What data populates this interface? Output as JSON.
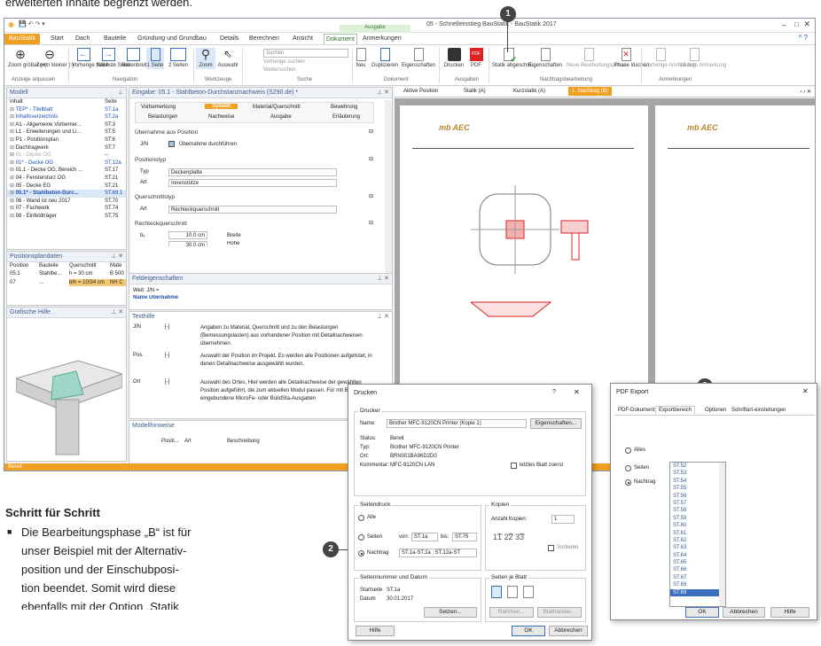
{
  "top_text": "erweiterten Inhalte begrenzt werden.",
  "window": {
    "title": "05 - Schnelleinstieg BauStatik - BauStatik 2017",
    "context_tab_group": "Ausgabe",
    "tabs": [
      "BauStatik",
      "Start",
      "Dach",
      "Bauteile",
      "Gründung und Grundbau",
      "Details",
      "Berechnen",
      "Ansicht",
      "Dokument",
      "Anmerkungen"
    ],
    "active_tab": "Dokument"
  },
  "ribbon": {
    "buttons": [
      {
        "label": "Zoom größer (+)",
        "icon": "zoom-in-icon"
      },
      {
        "label": "Zoom kleiner (-)",
        "icon": "zoom-out-icon"
      },
      {
        "label": "Vorherige Seite",
        "icon": "prev-page-icon"
      },
      {
        "label": "Nächste Seite",
        "icon": "next-page-icon"
      },
      {
        "label": "Seitenbreite",
        "icon": "page-width-icon"
      },
      {
        "label": "1 Seite",
        "icon": "one-page-icon"
      },
      {
        "label": "2 Seiten",
        "icon": "two-pages-icon"
      },
      {
        "label": "Zoom",
        "icon": "zoom-tool-icon"
      },
      {
        "label": "Auswahl",
        "icon": "select-cursor-icon"
      },
      {
        "label": "Neu",
        "icon": "new-doc-icon"
      },
      {
        "label": "Duplizieren",
        "icon": "duplicate-icon"
      },
      {
        "label": "Eigenschaften",
        "icon": "properties-icon"
      },
      {
        "label": "Drucken",
        "icon": "printer-icon"
      },
      {
        "label": "PDF",
        "icon": "pdf-icon"
      },
      {
        "label": "Statik abgeschlo...",
        "icon": "statik-done-icon"
      },
      {
        "label": "Eigenschaften",
        "icon": "properties-icon"
      },
      {
        "label": "Neue Bearbeitungsphase",
        "icon": "new-phase-icon"
      },
      {
        "label": "Phase löschen",
        "icon": "delete-phase-icon"
      },
      {
        "label": "Vorherige Anmerkung",
        "icon": "prev-note-icon"
      },
      {
        "label": "Nächste Anmerkung",
        "icon": "next-note-icon"
      }
    ],
    "search_placeholder": "Suchen",
    "search_prev": "Vorherige suchen",
    "search_next": "Weitersuchen",
    "groups": [
      "Anzeige anpassen",
      "Navigation",
      "Werkzeuge",
      "Suche",
      "Dokument",
      "Ausgaben",
      "Nachtragsbearbeitung",
      "Anmerkungen"
    ]
  },
  "model_panel": {
    "title": "Modell",
    "col_inhalt": "Inhalt",
    "col_seite": "Seite",
    "items": [
      {
        "label": "TEP* - Titelblatt",
        "page": "ST.1a",
        "style": "blue"
      },
      {
        "label": "Inhaltsverzeichnis",
        "page": "ST.2a",
        "style": "blue"
      },
      {
        "label": "A1 - Allgemeine Vorbemer...",
        "page": "ST.3",
        "style": ""
      },
      {
        "label": "L1 - Erweiterungen und Li...",
        "page": "ST.5",
        "style": ""
      },
      {
        "label": "P1 - Positionsplan",
        "page": "ST.6",
        "style": ""
      },
      {
        "label": "Dachtragwerk",
        "page": "ST.7",
        "style": ""
      },
      {
        "label": "01 - Decke OG",
        "page": "--",
        "style": "gray"
      },
      {
        "label": "01* - Decke OG",
        "page": "ST.12a",
        "style": "blue"
      },
      {
        "label": "01.1 - Decke OG, Bereich ...",
        "page": "ST.17",
        "style": ""
      },
      {
        "label": "04 - Fenstersturz OG",
        "page": "ST.21",
        "style": ""
      },
      {
        "label": "05 - Decke EG",
        "page": "ST.21",
        "style": ""
      },
      {
        "label": "05.1* - Stahlbeton-Durc...",
        "page": "ST.69.1",
        "style": "bold"
      },
      {
        "label": "06 - Wand ist neu 2017",
        "page": "ST.70",
        "style": ""
      },
      {
        "label": "07 - Fachwerk",
        "page": "ST.74",
        "style": ""
      },
      {
        "label": "08 - Einfeldträger",
        "page": "ST.75",
        "style": ""
      }
    ]
  },
  "position_panel": {
    "title": "Positionsplandaten",
    "headers": [
      "Position",
      "Bauteile",
      "Querschnitt",
      "Mate"
    ],
    "rows": [
      [
        "05.1",
        "Stahlbe...",
        "h = 30 cm",
        "B 500"
      ],
      [
        "07",
        "...",
        "b/h = 10/34 cm",
        "NH C"
      ]
    ]
  },
  "help_panel": {
    "title": "Grafische Hilfe"
  },
  "input_panel": {
    "title": "Eingabe: 05.1 - Stahlbeton-Durchstanznachweis (S290.de) *",
    "tabs_row1": [
      "Vorbemerkung",
      "System",
      "Material/Querschnitt",
      "Bewehrung"
    ],
    "tabs_row2": [
      "Belastungen",
      "Nachweise",
      "Ausgabe",
      "Erläuterung"
    ],
    "active_tab": "System",
    "sec_uebernahme": "Übernahme aus Position",
    "jn": "J/N",
    "uebernahme_check": "Übernahme durchführen",
    "sec_positionstyp": "Positionstyp",
    "typ_label": "Typ",
    "typ_value": "Deckenplatte",
    "art_label": "Art",
    "art_value": "Innenstütze",
    "sec_querschnittstyp": "Querschnittstyp",
    "qart_value": "Rechteckquerschnitt",
    "sec_rechteck": "Rechteckquerschnitt",
    "bx_label": "bₓ",
    "bx_value": "10.0 cm",
    "bx_desc": "Breite",
    "by_value": "30.0 cm",
    "by_desc": "Höhe"
  },
  "field_panel": {
    "title": "Feldeigenschaften",
    "line1": "Weit: J/N =",
    "line2": "Name Übernahme"
  },
  "text_panel": {
    "title": "Texthilfe",
    "rows": [
      {
        "key": "J/N",
        "type": "[-]",
        "text": "Angaben zu Material, Querschnitt und zu den Belastungen (Bemessungslasten) aus vorhandener Position mit Detailnachweisen übernehmen."
      },
      {
        "key": "Pos.",
        "type": "[-]",
        "text": "Auswahl der Position im Projekt. Es werden alle Positionen aufgelistet, in denen Detailnachweise ausgewählt wurden."
      },
      {
        "key": "Ort",
        "type": "[-]",
        "text": "Auswahl des Ortes. Hier werden alle Detailnachweise der gewählten Position aufgeführt, die zum aktuellen Modul passen. Für mit BO19 eingebundene MicroFe- oder BuildSta-Ausgaben"
      }
    ]
  },
  "notes_panel": {
    "title": "Modellhinweise",
    "headers": [
      "Positi...",
      "Art",
      "Beschreibung"
    ]
  },
  "doc_tabs": [
    "Aktive Position",
    "Statik (A)",
    "Kurzstatik (A)",
    "1. Nachtrag (B)"
  ],
  "status_bar": "Bereit",
  "print_dialog": {
    "title": "Drucken",
    "help_q": "?",
    "sec_printer": "Drucker",
    "name_label": "Name:",
    "name_value": "Brother MFC-9120CN Printer (Kopie 1)",
    "props_button": "Eigenschaften...",
    "status_label": "Status:",
    "status_value": "Bereit",
    "type_label": "Typ:",
    "type_value": "Brother MFC-9120CN Printer",
    "ort_label": "Ort:",
    "ort_value": "BRN001BA96D2D0",
    "comment_label": "Kommentar:",
    "comment_value": "MFC-9120CN LAN",
    "last_sheet": "letztes Blatt zuerst",
    "sec_range": "Seitendruck",
    "opt_all": "Alle",
    "opt_pages": "Seiten",
    "from_label": "von:",
    "from_value": "ST.1a",
    "to_label": "bis:",
    "to_value": "ST.75",
    "opt_nachtrag": "Nachtrag",
    "nachtrag_value": "ST.1a-ST.2a ; ST.12a-ST",
    "sec_copies": "Kopien",
    "copies_label": "Anzahl Kopien:",
    "copies_value": "1",
    "sortieren": "Sortieren",
    "sec_numbering": "Seitennummer und Datum",
    "startpage_label": "Startseite",
    "startpage_value": "ST.1a",
    "date_label": "Datum",
    "date_value": "30.01.2017",
    "set_button": "Setzen...",
    "sec_per_sheet": "Seiten je Blatt",
    "rahmen": "Rahmen...",
    "blattraender": "Blattränder...",
    "help_button": "Hilfe",
    "ok_button": "OK",
    "cancel_button": "Abbrechen"
  },
  "pdf_dialog": {
    "title": "PDF Export",
    "tabs": [
      "PDF-Dokument",
      "Exportbereich",
      "Optionen",
      "Schriftart-einstellungen"
    ],
    "active_tab": "Exportbereich",
    "opt_all": "Alles",
    "opt_pages": "Seiten",
    "opt_nachtrag": "Nachtrag",
    "list": [
      "ST.52",
      "ST.53",
      "ST.54",
      "ST.55",
      "ST.56",
      "ST.57",
      "ST.58",
      "ST.59",
      "ST.60",
      "ST.61",
      "ST.62",
      "ST.63",
      "ST.64",
      "ST.65",
      "ST.66",
      "ST.67",
      "ST.68",
      "ST.69"
    ],
    "ok_button": "OK",
    "cancel_button": "Abbrechen",
    "help_button": "Hilfe"
  },
  "callouts": [
    "1",
    "2",
    "3"
  ],
  "article": {
    "heading": "Schritt für Schritt",
    "lines": [
      "Die Bearbeitungsphase „B“ ist für",
      "unser Beispiel mit der Alternativ-",
      "position und der Einschubposi-",
      "tion beendet. Somit wird diese",
      "ebenfalls mit der Option „Statik"
    ]
  },
  "colors": {
    "accent": "#f0a020",
    "brand_blue": "#1d4fb3",
    "status_bar": "#f0a020"
  }
}
